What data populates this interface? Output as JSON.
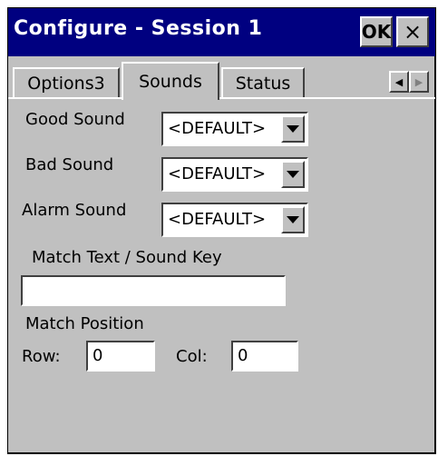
{
  "window": {
    "title": "Configure - Session 1",
    "ok_label": "OK",
    "close_label": "×"
  },
  "tabs": [
    {
      "label": "Options3"
    },
    {
      "label": "Sounds"
    },
    {
      "label": "Status"
    }
  ],
  "sounds": {
    "good_sound": {
      "label": "Good Sound",
      "value": "<DEFAULT>"
    },
    "bad_sound": {
      "label": "Bad Sound",
      "value": "<DEFAULT>"
    },
    "alarm_sound": {
      "label": "Alarm Sound",
      "value": "<DEFAULT>"
    },
    "match_text": {
      "label": "Match Text / Sound Key",
      "value": ""
    },
    "match_position": {
      "label": "Match Position",
      "row_label": "Row:",
      "row_value": "0",
      "col_label": "Col:",
      "col_value": "0"
    }
  }
}
